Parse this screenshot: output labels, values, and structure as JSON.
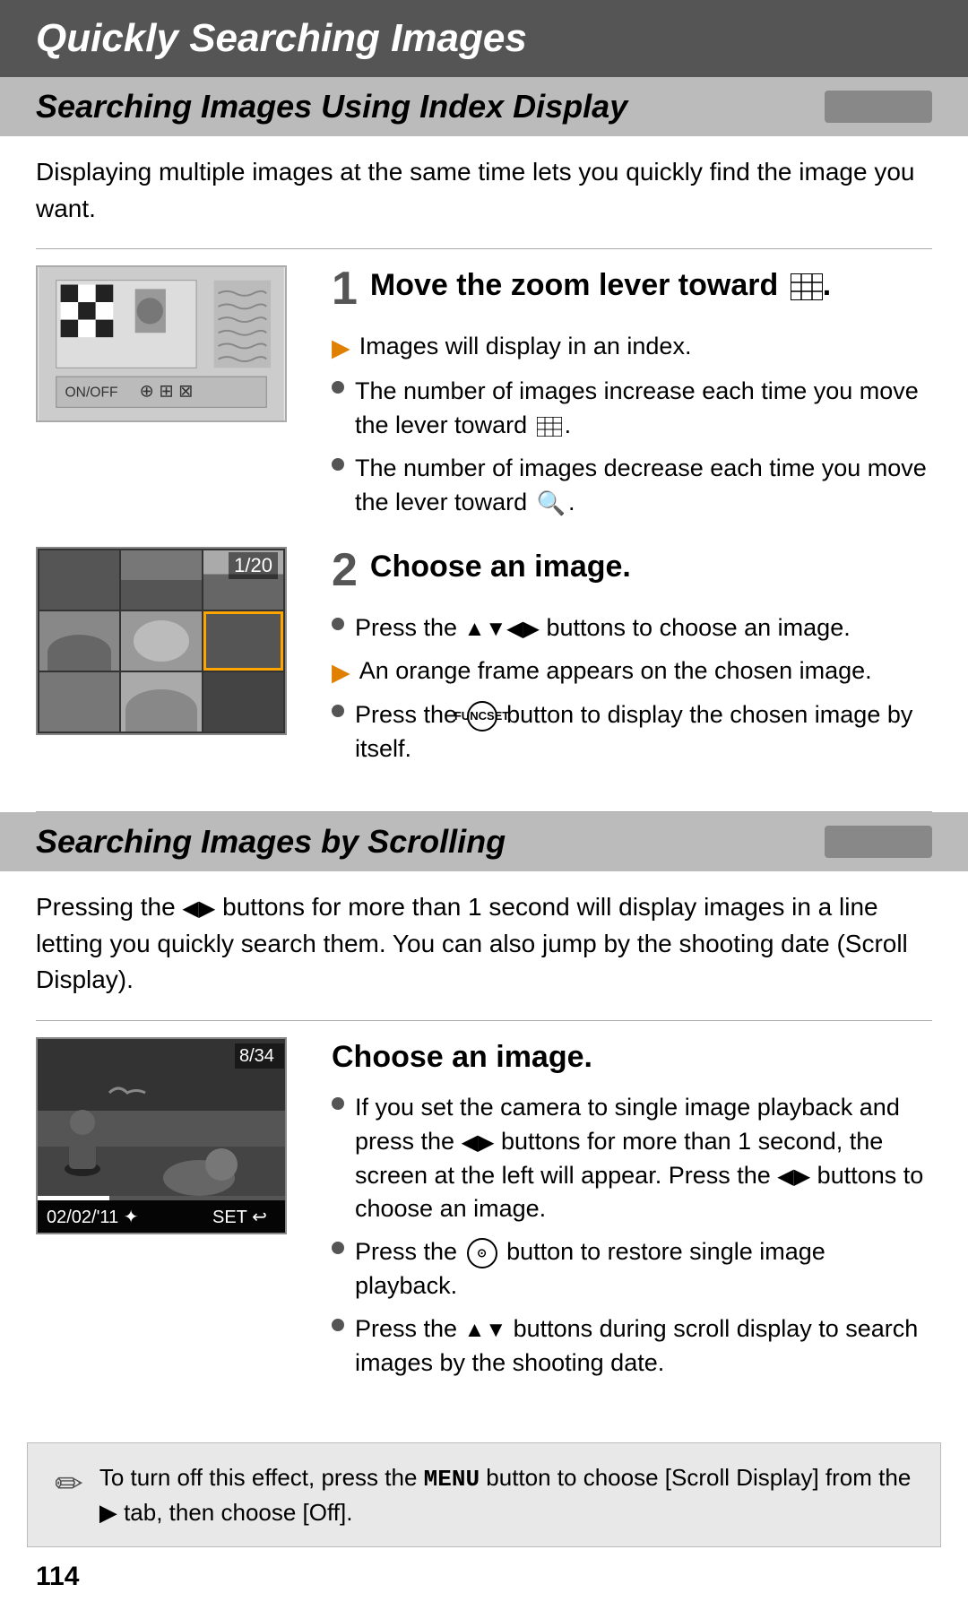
{
  "page": {
    "title": "Quickly Searching Images",
    "page_number": "114",
    "sections": [
      {
        "id": "index-display",
        "title": "Searching Images Using Index Display",
        "intro": "Displaying multiple images at the same time lets you quickly find the image you want.",
        "steps": [
          {
            "number": "1",
            "title": "Move the zoom lever toward",
            "bullets": [
              {
                "type": "arrow-orange",
                "text": "Images will display in an index."
              },
              {
                "type": "dot",
                "text": "The number of images increase each time you move the lever toward"
              },
              {
                "type": "dot",
                "text": "The number of images decrease each time you move the lever toward"
              }
            ]
          },
          {
            "number": "2",
            "title": "Choose an image.",
            "bullets": [
              {
                "type": "dot",
                "text": "Press the ▲▼◀▶ buttons to choose an image."
              },
              {
                "type": "arrow-orange",
                "text": "An orange frame appears on the chosen image."
              },
              {
                "type": "dot",
                "text": "Press the FUNC button to display the chosen image by itself."
              }
            ]
          }
        ]
      },
      {
        "id": "scrolling",
        "title": "Searching Images by Scrolling",
        "intro": "Pressing the ◀▶ buttons for more than 1 second will display images in a line letting you quickly search them. You can also jump by the shooting date (Scroll Display).",
        "step": {
          "title": "Choose an image.",
          "bullets": [
            {
              "type": "dot",
              "text": "If you set the camera to single image playback and press the ◀▶ buttons for more than 1 second, the screen at the left will appear. Press the ◀▶ buttons to choose an image."
            },
            {
              "type": "dot",
              "text": "Press the FUNC button to restore single image playback."
            },
            {
              "type": "dot",
              "text": "Press the ▲▼ buttons during scroll display to search images by the shooting date."
            }
          ]
        }
      }
    ],
    "note": "To turn off this effect, press the MENU button to choose [Scroll Display] from the ▶ tab, then choose [Off].",
    "grid_counter": "1/20",
    "scroll_counter": "8/34",
    "scroll_date": "02/02/'11 ✦",
    "scroll_set": "SET ↩"
  }
}
